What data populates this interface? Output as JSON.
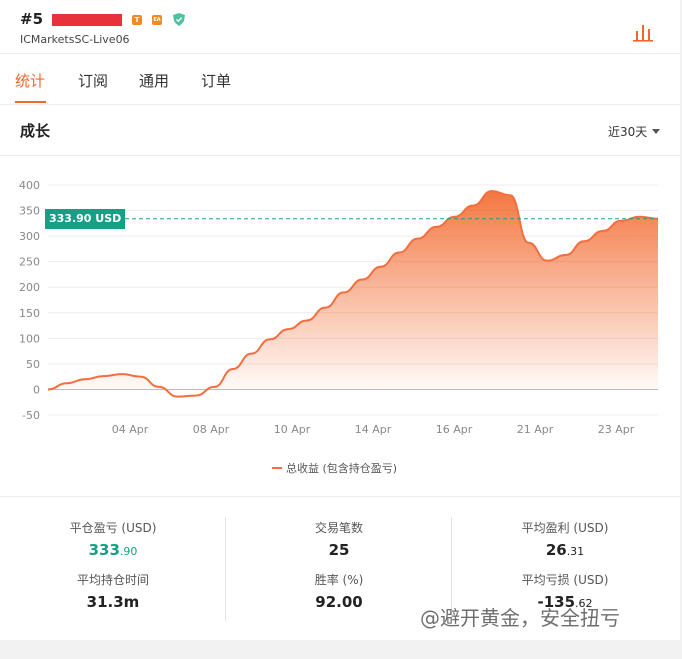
{
  "account": {
    "number": "#5",
    "server": "ICMarketsSC-Live06",
    "badges": [
      "T",
      "EA"
    ]
  },
  "tabs": [
    {
      "label": "统计",
      "active": true
    },
    {
      "label": "订阅",
      "active": false
    },
    {
      "label": "通用",
      "active": false
    },
    {
      "label": "订单",
      "active": false
    }
  ],
  "growth": {
    "title": "成长",
    "period": "近30天"
  },
  "chart_data": {
    "type": "area",
    "y_ticks": [
      "400",
      "350",
      "300",
      "250",
      "200",
      "150",
      "100",
      "50",
      "0",
      "-50"
    ],
    "ylim": [
      -50,
      400
    ],
    "x_ticks": [
      "04 Apr",
      "08 Apr",
      "10 Apr",
      "14 Apr",
      "16 Apr",
      "21 Apr",
      "23 Apr"
    ],
    "series": [
      {
        "name": "总收益 (包含持仓盈亏)",
        "values": [
          0,
          12,
          20,
          26,
          30,
          25,
          5,
          -14,
          -12,
          5,
          40,
          70,
          98,
          118,
          135,
          160,
          190,
          215,
          240,
          268,
          295,
          318,
          338,
          360,
          388,
          380,
          287,
          252,
          263,
          290,
          310,
          330,
          338,
          333.9
        ]
      }
    ],
    "reference_line": {
      "value": 333.9,
      "label": "333.90 USD"
    },
    "grid": true,
    "legend_position": "bottom",
    "colors": {
      "line": "#f26e3f",
      "fill": "#f2682c",
      "reference": "#15a086"
    }
  },
  "stats": {
    "closed_pnl": {
      "label": "平仓盈亏 (USD)",
      "int": "333",
      "frac": ".90"
    },
    "avg_hold": {
      "label": "平均持仓时间",
      "value": "31.3m"
    },
    "trades": {
      "label": "交易笔数",
      "value": "25"
    },
    "win_rate": {
      "label": "胜率 (%)",
      "value": "92.00"
    },
    "avg_profit": {
      "label": "平均盈利 (USD)",
      "int": "26",
      "frac": ".31"
    },
    "avg_loss": {
      "label": "平均亏损 (USD)",
      "int": "-135",
      "frac": ".62"
    }
  },
  "watermark": "@避开黄金，安全扭亏",
  "colors": {
    "accent": "#f2682c",
    "green": "#15a086"
  }
}
